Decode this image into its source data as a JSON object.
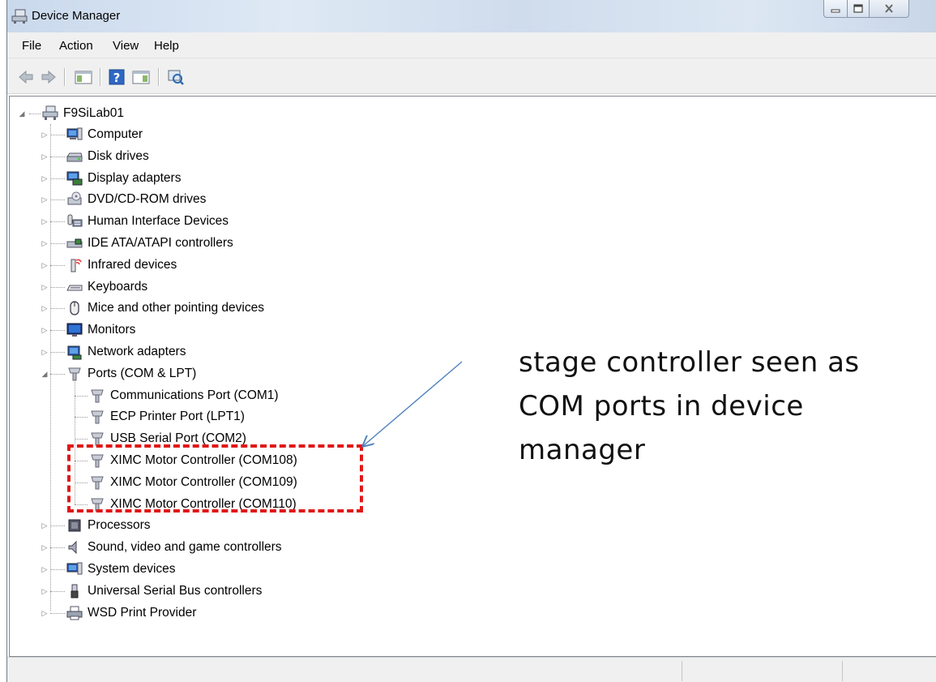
{
  "window": {
    "title": "Device Manager",
    "icon": "device-manager-icon",
    "controls": {
      "minimize": "minimize-icon",
      "maximize": "maximize-icon",
      "close": "close-icon"
    }
  },
  "menu": {
    "file": "File",
    "action": "Action",
    "view": "View",
    "help": "Help"
  },
  "toolbar": {
    "icons": [
      "back-arrow-icon",
      "forward-arrow-icon",
      "show-hide-console-tree-icon",
      "help-icon",
      "show-hide-action-pane-icon",
      "scan-hardware-changes-icon"
    ]
  },
  "tree": {
    "root": {
      "label": "F9SiLab01",
      "icon": "computer-network-icon",
      "expanded": true
    },
    "categories": [
      {
        "label": "Computer",
        "icon": "computer-icon",
        "expanded": false
      },
      {
        "label": "Disk drives",
        "icon": "disk-drive-icon",
        "expanded": false
      },
      {
        "label": "Display adapters",
        "icon": "display-adapter-icon",
        "expanded": false
      },
      {
        "label": "DVD/CD-ROM drives",
        "icon": "dvd-drive-icon",
        "expanded": false
      },
      {
        "label": "Human Interface Devices",
        "icon": "hid-icon",
        "expanded": false
      },
      {
        "label": "IDE ATA/ATAPI controllers",
        "icon": "ide-controller-icon",
        "expanded": false
      },
      {
        "label": "Infrared devices",
        "icon": "infrared-icon",
        "expanded": false
      },
      {
        "label": "Keyboards",
        "icon": "keyboard-icon",
        "expanded": false
      },
      {
        "label": "Mice and other pointing devices",
        "icon": "mouse-icon",
        "expanded": false
      },
      {
        "label": "Monitors",
        "icon": "monitor-icon",
        "expanded": false
      },
      {
        "label": "Network adapters",
        "icon": "network-adapter-icon",
        "expanded": false
      },
      {
        "label": "Ports (COM & LPT)",
        "icon": "port-icon",
        "expanded": true
      }
    ],
    "ports": [
      {
        "label": "Communications Port (COM1)",
        "icon": "port-icon"
      },
      {
        "label": "ECP Printer Port (LPT1)",
        "icon": "port-icon"
      },
      {
        "label": "USB Serial Port (COM2)",
        "icon": "port-icon"
      },
      {
        "label": "XIMC Motor Controller (COM108)",
        "icon": "port-icon"
      },
      {
        "label": "XIMC Motor Controller (COM109)",
        "icon": "port-icon"
      },
      {
        "label": "XIMC Motor Controller (COM110)",
        "icon": "port-icon"
      }
    ],
    "categories_after": [
      {
        "label": "Processors",
        "icon": "processor-icon",
        "expanded": false
      },
      {
        "label": "Sound, video and game controllers",
        "icon": "speaker-icon",
        "expanded": false
      },
      {
        "label": "System devices",
        "icon": "system-device-icon",
        "expanded": false
      },
      {
        "label": "Universal Serial Bus controllers",
        "icon": "usb-icon",
        "expanded": false
      },
      {
        "label": "WSD Print Provider",
        "icon": "printer-icon",
        "expanded": false
      }
    ]
  },
  "annotation": {
    "text": "stage controller seen as COM ports in device manager",
    "highlight_color": "#e01818",
    "arrow_color": "#4f81bd"
  }
}
